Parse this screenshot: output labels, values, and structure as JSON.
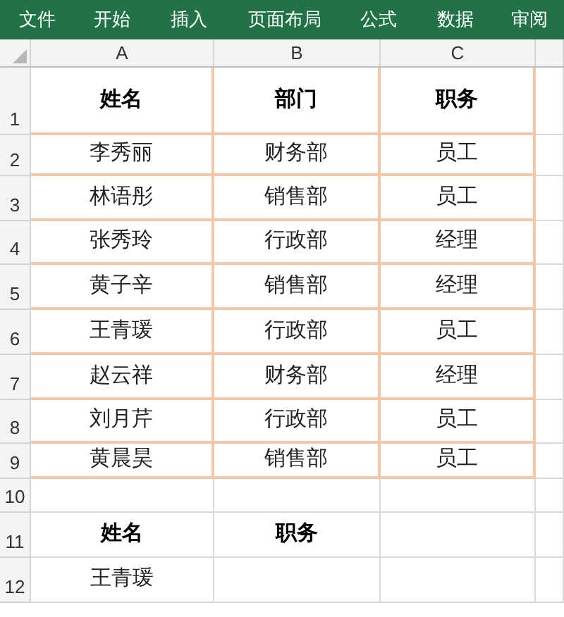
{
  "ribbon": {
    "tabs": [
      "文件",
      "开始",
      "插入",
      "页面布局",
      "公式",
      "数据",
      "审阅"
    ]
  },
  "columns": [
    "A",
    "B",
    "C"
  ],
  "rows": [
    {
      "number": "1",
      "kind": "table-header",
      "cells": [
        "姓名",
        "部门",
        "职务"
      ]
    },
    {
      "number": "2",
      "kind": "table-row",
      "cells": [
        "李秀丽",
        "财务部",
        "员工"
      ]
    },
    {
      "number": "3",
      "kind": "table-row",
      "cells": [
        "林语彤",
        "销售部",
        "员工"
      ]
    },
    {
      "number": "4",
      "kind": "table-row",
      "cells": [
        "张秀玲",
        "行政部",
        "经理"
      ]
    },
    {
      "number": "5",
      "kind": "table-row",
      "cells": [
        "黄子辛",
        "销售部",
        "经理"
      ]
    },
    {
      "number": "6",
      "kind": "table-row",
      "cells": [
        "王青瑗",
        "行政部",
        "员工"
      ]
    },
    {
      "number": "7",
      "kind": "table-row",
      "cells": [
        "赵云祥",
        "财务部",
        "经理"
      ]
    },
    {
      "number": "8",
      "kind": "table-row",
      "cells": [
        "刘月芹",
        "行政部",
        "员工"
      ]
    },
    {
      "number": "9",
      "kind": "table-row",
      "cells": [
        "黄晨昊",
        "销售部",
        "员工"
      ]
    },
    {
      "number": "10",
      "kind": "plain",
      "cells": []
    },
    {
      "number": "11",
      "kind": "plain-header",
      "cells": [
        "姓名",
        "职务"
      ]
    },
    {
      "number": "12",
      "kind": "plain",
      "cells": [
        "王青瑗"
      ]
    }
  ]
}
